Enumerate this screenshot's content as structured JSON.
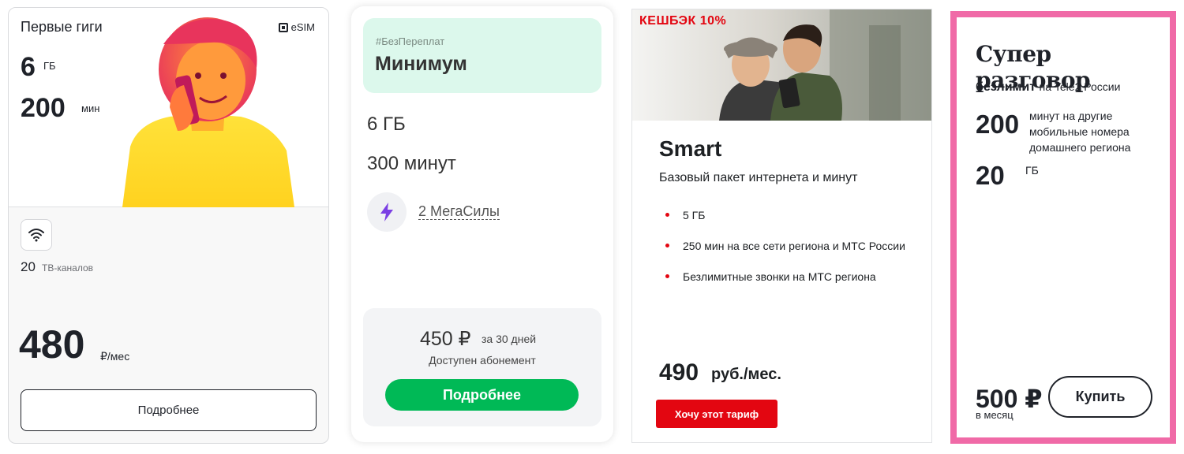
{
  "cards": [
    {
      "title": "Первые гиги",
      "esim_label": "eSIM",
      "data_value": "6",
      "data_unit": "ГБ",
      "minutes_value": "200",
      "minutes_unit": "мин",
      "tv_count": "20",
      "tv_label": "ТВ-каналов",
      "price_value": "480",
      "price_unit": "₽/мес",
      "button_label": "Подробнее",
      "icons": [
        "esim-chip-icon",
        "wifi-icon"
      ]
    },
    {
      "tag": "#БезПереплат",
      "title": "Минимум",
      "data": "6 ГБ",
      "minutes": "300 минут",
      "power_label": "2 МегаСилы",
      "price_value": "450 ₽",
      "price_period": "за 30 дней",
      "subscription_note": "Доступен абонемент",
      "button_label": "Подробнее",
      "accent_color": "#00b956",
      "icons": [
        "lightning-icon"
      ]
    },
    {
      "badge": "КЕШБЭК 10%",
      "title": "Smart",
      "description": "Базовый пакет интернета и минут",
      "features": [
        "5 ГБ",
        "250 мин на все сети региона и МТС России",
        "Безлимитные звонки на МТС региона"
      ],
      "price_value": "490",
      "price_unit": "руб./мес.",
      "button_label": "Хочу этот тариф",
      "accent_color": "#e30611"
    },
    {
      "title": "Супер разговор",
      "unlimited_bold": "безлимит",
      "unlimited_rest": "на Tele2 России",
      "minutes_value": "200",
      "minutes_label": "минут на другие мобильные номера домашнего региона",
      "data_value": "20",
      "data_unit": "ГБ",
      "price_value": "500 ₽",
      "price_period": "в месяц",
      "button_label": "Купить",
      "border_color": "#f06aa7"
    }
  ]
}
